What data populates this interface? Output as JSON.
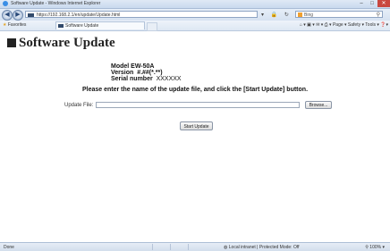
{
  "window": {
    "title": "Software Update - Windows Internet Explorer",
    "controls": {
      "minimize": "–",
      "maximize": "□",
      "close": "✕"
    }
  },
  "address_bar": {
    "back_icon": "back-arrow-icon",
    "forward_icon": "forward-arrow-icon",
    "url": "https://192.168.2.1/en/update/Update.html",
    "buttons": "▾ 🔒 ↻ ✕",
    "search_text": "Bing",
    "search_icon": "magnifier-icon"
  },
  "tab_bar": {
    "favorites_label": "Favorites",
    "tab_label": "Software Update",
    "command_bar": "⌂ ▾  ▣ ▾  ✉ ▾  ⎙ ▾  Page ▾  Safety ▾  Tools ▾  ❓▾"
  },
  "page": {
    "title": "Software Update",
    "model_label": "Model EW-50A",
    "version_label": "Version",
    "version_value": "#.##(*.**)",
    "serial_label": "Serial number",
    "serial_value": "XXXXXX",
    "instruction": "Please enter the name of the update file, and click the [Start Update] button.",
    "update_file_label": "Update File:",
    "update_file_value": "",
    "browse_label": "Browse...",
    "start_update_label": "Start Update"
  },
  "status_bar": {
    "done": "Done",
    "zone": "Local intranet | Protected Mode: Off",
    "zoom": "100%"
  },
  "colors": {
    "chrome_blue": "#d6e2f1",
    "close_red": "#c9473f",
    "text": "#111111"
  }
}
